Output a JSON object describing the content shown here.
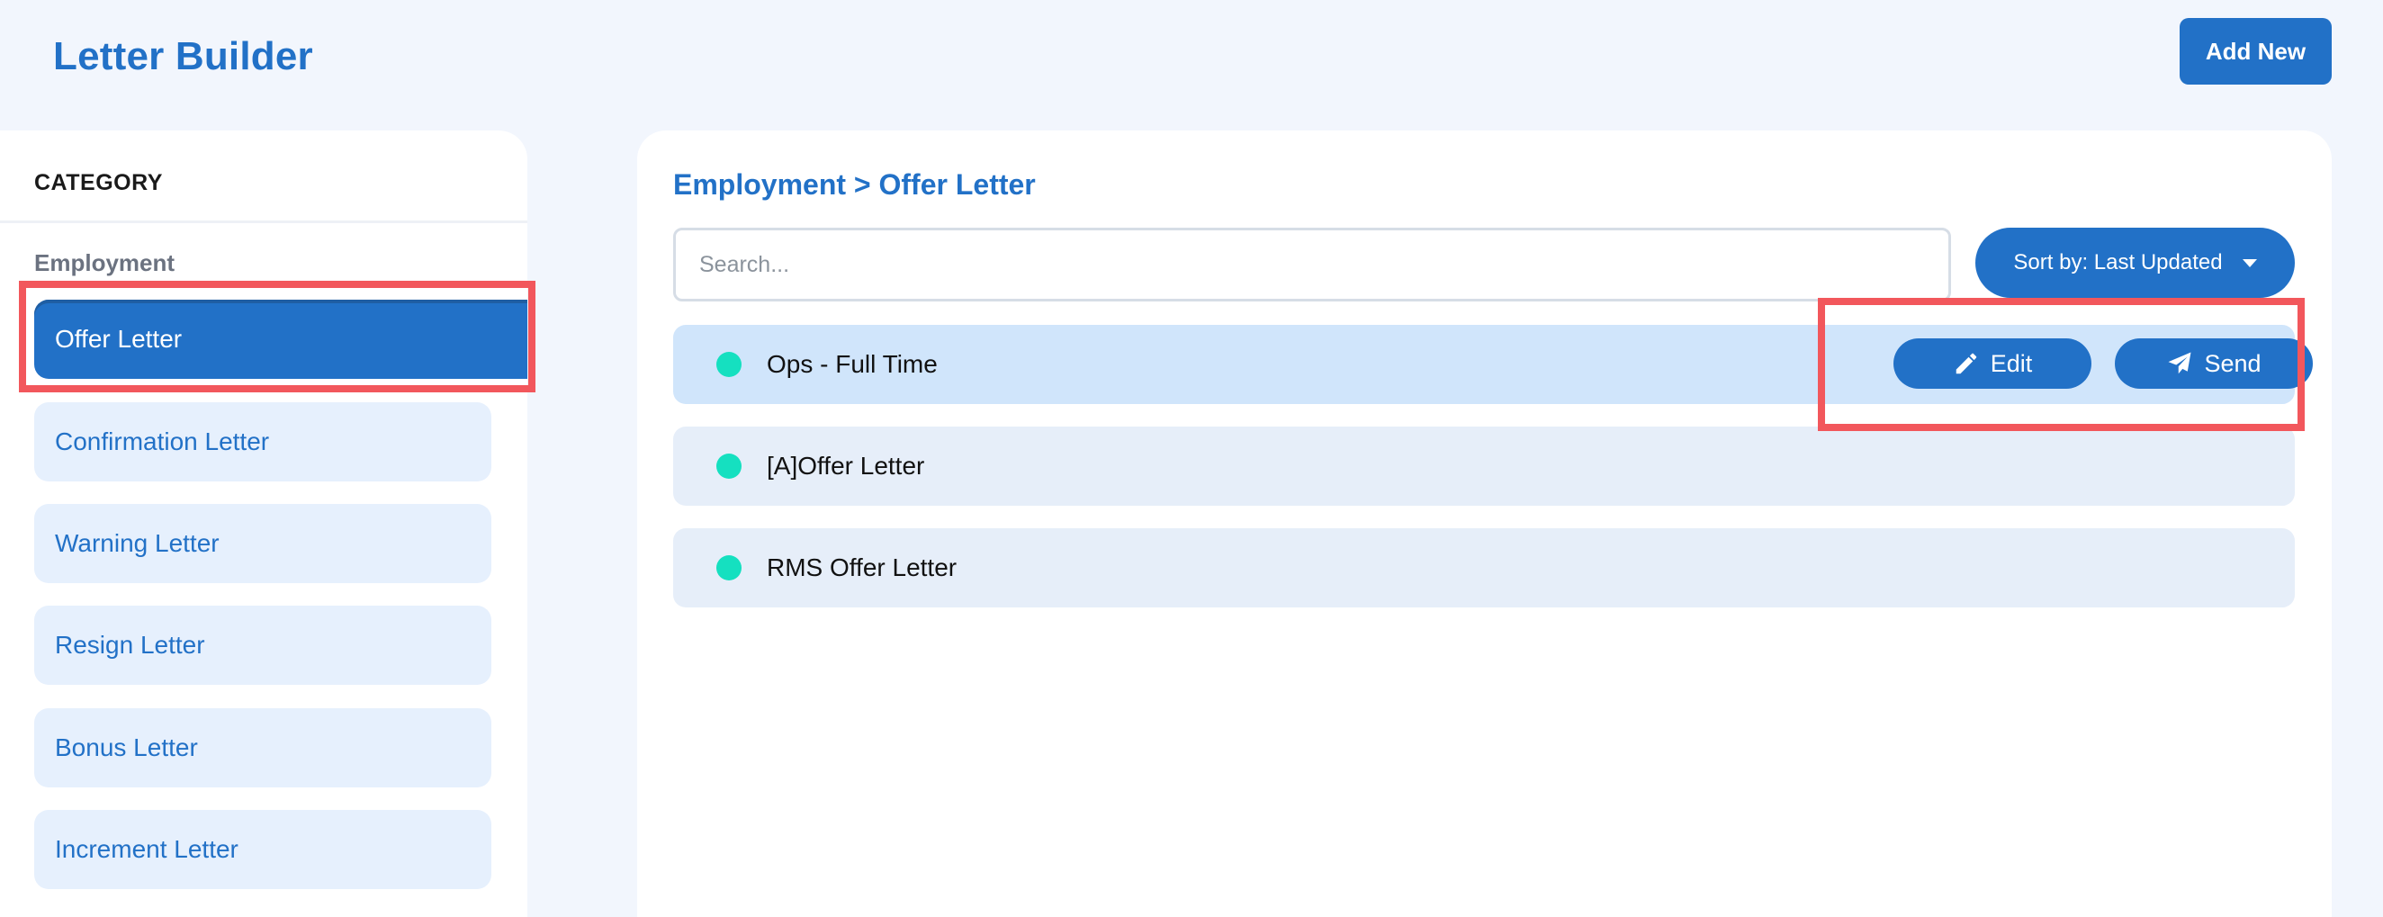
{
  "header": {
    "title": "Letter Builder",
    "add_new_label": "Add New"
  },
  "sidebar": {
    "heading": "CATEGORY",
    "group_label": "Employment",
    "items": [
      {
        "label": "Offer Letter",
        "active": true
      },
      {
        "label": "Confirmation Letter",
        "active": false
      },
      {
        "label": "Warning Letter",
        "active": false
      },
      {
        "label": "Resign Letter",
        "active": false
      },
      {
        "label": "Bonus Letter",
        "active": false
      },
      {
        "label": "Increment Letter",
        "active": false
      }
    ]
  },
  "main": {
    "breadcrumb": "Employment > Offer Letter",
    "search": {
      "placeholder": "Search...",
      "value": ""
    },
    "sort_label": "Sort by: Last Updated",
    "rows": [
      {
        "name": "Ops - Full Time",
        "status_color": "#15e0c0",
        "selected": true
      },
      {
        "name": "[A]Offer Letter",
        "status_color": "#15e0c0",
        "selected": false
      },
      {
        "name": "RMS Offer Letter",
        "status_color": "#15e0c0",
        "selected": false
      }
    ],
    "actions": {
      "edit_label": "Edit",
      "send_label": "Send",
      "edit_icon": "pencil-icon",
      "send_icon": "paper-plane-icon"
    }
  },
  "colors": {
    "accent": "#2271c7",
    "background": "#f2f6fd",
    "status": "#15e0c0",
    "highlight": "#f2575c"
  }
}
